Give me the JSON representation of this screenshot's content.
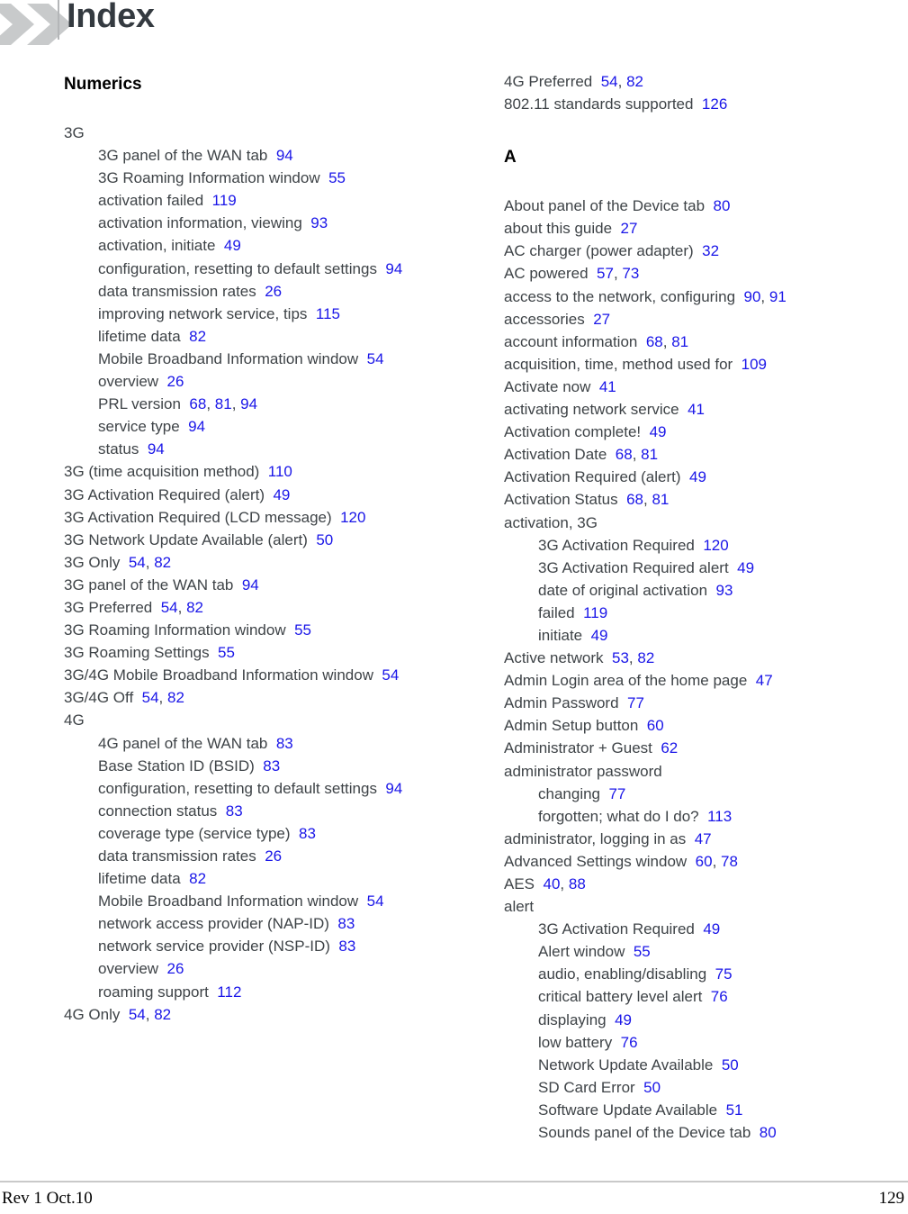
{
  "header": {
    "title": "Index",
    "chevron_icon": "double-chevron-right-icon",
    "chevron_color": "#c8cacb",
    "title_color": "#343a40"
  },
  "theme": {
    "body_text_color": "#3e4347",
    "page_number_color": "#1a16e8",
    "heading_color": "#000000",
    "rule_color": "#c9c9c9"
  },
  "columns": [
    {
      "name": "left-column",
      "sections": [
        {
          "heading": "Numerics",
          "entries": [
            {
              "level": 1,
              "text": "3G",
              "pages": []
            },
            {
              "level": 2,
              "text": "3G panel of the WAN tab",
              "pages": [
                "94"
              ]
            },
            {
              "level": 2,
              "text": "3G Roaming Information window",
              "pages": [
                "55"
              ]
            },
            {
              "level": 2,
              "text": "activation failed",
              "pages": [
                "119"
              ]
            },
            {
              "level": 2,
              "text": "activation information, viewing",
              "pages": [
                "93"
              ]
            },
            {
              "level": 2,
              "text": "activation, initiate",
              "pages": [
                "49"
              ]
            },
            {
              "level": 2,
              "wrap": true,
              "text": "configuration, resetting to default settings",
              "pages": [
                "94"
              ]
            },
            {
              "level": 2,
              "text": "data transmission rates",
              "pages": [
                "26"
              ]
            },
            {
              "level": 2,
              "text": "improving network service, tips",
              "pages": [
                "115"
              ]
            },
            {
              "level": 2,
              "text": "lifetime data",
              "pages": [
                "82"
              ]
            },
            {
              "level": 2,
              "wrap": true,
              "text": "Mobile Broadband Information window",
              "pages": [
                "54"
              ]
            },
            {
              "level": 2,
              "text": "overview",
              "pages": [
                "26"
              ]
            },
            {
              "level": 2,
              "text": "PRL version",
              "pages": [
                "68",
                "81",
                "94"
              ]
            },
            {
              "level": 2,
              "text": "service type",
              "pages": [
                "94"
              ]
            },
            {
              "level": 2,
              "text": "status",
              "pages": [
                "94"
              ]
            },
            {
              "level": 1,
              "text": "3G (time acquisition method)",
              "pages": [
                "110"
              ]
            },
            {
              "level": 1,
              "text": "3G Activation Required (alert)",
              "pages": [
                "49"
              ]
            },
            {
              "level": 1,
              "text": "3G Activation Required (LCD message)",
              "pages": [
                "120"
              ]
            },
            {
              "level": 1,
              "text": "3G Network Update Available (alert)",
              "pages": [
                "50"
              ]
            },
            {
              "level": 1,
              "text": "3G Only",
              "pages": [
                "54",
                "82"
              ]
            },
            {
              "level": 1,
              "text": "3G panel of the WAN tab",
              "pages": [
                "94"
              ]
            },
            {
              "level": 1,
              "text": "3G Preferred",
              "pages": [
                "54",
                "82"
              ]
            },
            {
              "level": 1,
              "text": "3G Roaming Information window",
              "pages": [
                "55"
              ]
            },
            {
              "level": 1,
              "text": "3G Roaming Settings",
              "pages": [
                "55"
              ]
            },
            {
              "level": 1,
              "wrap": true,
              "text": "3G/4G Mobile Broadband Information window",
              "pages": [
                "54"
              ]
            },
            {
              "level": 1,
              "text": "3G/4G Off",
              "pages": [
                "54",
                "82"
              ]
            },
            {
              "level": 1,
              "text": "4G",
              "pages": []
            },
            {
              "level": 2,
              "text": "4G panel of the WAN tab",
              "pages": [
                "83"
              ]
            },
            {
              "level": 2,
              "text": "Base Station ID (BSID)",
              "pages": [
                "83"
              ]
            },
            {
              "level": 2,
              "wrap": true,
              "text": "configuration, resetting to default settings",
              "pages": [
                "94"
              ]
            },
            {
              "level": 2,
              "text": "connection status",
              "pages": [
                "83"
              ]
            },
            {
              "level": 2,
              "text": "coverage type (service type)",
              "pages": [
                "83"
              ]
            },
            {
              "level": 2,
              "text": "data transmission rates",
              "pages": [
                "26"
              ]
            },
            {
              "level": 2,
              "text": "lifetime data",
              "pages": [
                "82"
              ]
            },
            {
              "level": 2,
              "wrap": true,
              "text": "Mobile Broadband Information window",
              "pages": [
                "54"
              ]
            },
            {
              "level": 2,
              "text": "network access provider (NAP-ID)",
              "pages": [
                "83"
              ]
            },
            {
              "level": 2,
              "text": "network service provider (NSP-ID)",
              "pages": [
                "83"
              ]
            },
            {
              "level": 2,
              "text": "overview",
              "pages": [
                "26"
              ]
            },
            {
              "level": 2,
              "text": "roaming support",
              "pages": [
                "112"
              ]
            },
            {
              "level": 1,
              "text": "4G Only",
              "pages": [
                "54",
                "82"
              ]
            }
          ]
        }
      ]
    },
    {
      "name": "right-column",
      "sections": [
        {
          "heading": null,
          "entries": [
            {
              "level": 1,
              "text": "4G Preferred",
              "pages": [
                "54",
                "82"
              ]
            },
            {
              "level": 1,
              "text": "802.11 standards supported",
              "pages": [
                "126"
              ]
            }
          ]
        },
        {
          "heading": "A",
          "entries": [
            {
              "level": 1,
              "text": "About panel of the Device tab",
              "pages": [
                "80"
              ]
            },
            {
              "level": 1,
              "text": "about this guide",
              "pages": [
                "27"
              ]
            },
            {
              "level": 1,
              "text": "AC charger (power adapter)",
              "pages": [
                "32"
              ]
            },
            {
              "level": 1,
              "text": "AC powered",
              "pages": [
                "57",
                "73"
              ]
            },
            {
              "level": 1,
              "text": "access to the network, configuring",
              "pages": [
                "90",
                "91"
              ]
            },
            {
              "level": 1,
              "text": "accessories",
              "pages": [
                "27"
              ]
            },
            {
              "level": 1,
              "text": "account information",
              "pages": [
                "68",
                "81"
              ]
            },
            {
              "level": 1,
              "text": "acquisition, time, method used for",
              "pages": [
                "109"
              ]
            },
            {
              "level": 1,
              "text": "Activate now",
              "pages": [
                "41"
              ]
            },
            {
              "level": 1,
              "text": "activating network service",
              "pages": [
                "41"
              ]
            },
            {
              "level": 1,
              "text": "Activation complete!",
              "pages": [
                "49"
              ]
            },
            {
              "level": 1,
              "text": "Activation Date",
              "pages": [
                "68",
                "81"
              ]
            },
            {
              "level": 1,
              "text": "Activation Required (alert)",
              "pages": [
                "49"
              ]
            },
            {
              "level": 1,
              "text": "Activation Status",
              "pages": [
                "68",
                "81"
              ]
            },
            {
              "level": 1,
              "text": "activation, 3G",
              "pages": []
            },
            {
              "level": 2,
              "text": "3G Activation Required",
              "pages": [
                "120"
              ]
            },
            {
              "level": 2,
              "text": "3G Activation Required alert",
              "pages": [
                "49"
              ]
            },
            {
              "level": 2,
              "text": "date of original activation",
              "pages": [
                "93"
              ]
            },
            {
              "level": 2,
              "text": "failed",
              "pages": [
                "119"
              ]
            },
            {
              "level": 2,
              "text": "initiate",
              "pages": [
                "49"
              ]
            },
            {
              "level": 1,
              "text": "Active network",
              "pages": [
                "53",
                "82"
              ]
            },
            {
              "level": 1,
              "text": "Admin Login area of the home page",
              "pages": [
                "47"
              ]
            },
            {
              "level": 1,
              "text": "Admin Password",
              "pages": [
                "77"
              ]
            },
            {
              "level": 1,
              "text": "Admin Setup button",
              "pages": [
                "60"
              ]
            },
            {
              "level": 1,
              "text": "Administrator + Guest",
              "pages": [
                "62"
              ]
            },
            {
              "level": 1,
              "text": "administrator password",
              "pages": []
            },
            {
              "level": 2,
              "text": "changing",
              "pages": [
                "77"
              ]
            },
            {
              "level": 2,
              "text": "forgotten; what do I do?",
              "pages": [
                "113"
              ]
            },
            {
              "level": 1,
              "text": "administrator, logging in as",
              "pages": [
                "47"
              ]
            },
            {
              "level": 1,
              "text": "Advanced Settings window",
              "pages": [
                "60",
                "78"
              ]
            },
            {
              "level": 1,
              "text": "AES",
              "pages": [
                "40",
                "88"
              ]
            },
            {
              "level": 1,
              "text": "alert",
              "pages": []
            },
            {
              "level": 2,
              "text": "3G Activation Required",
              "pages": [
                "49"
              ]
            },
            {
              "level": 2,
              "text": "Alert window",
              "pages": [
                "55"
              ]
            },
            {
              "level": 2,
              "text": "audio, enabling/disabling",
              "pages": [
                "75"
              ]
            },
            {
              "level": 2,
              "text": "critical battery level alert",
              "pages": [
                "76"
              ]
            },
            {
              "level": 2,
              "text": "displaying",
              "pages": [
                "49"
              ]
            },
            {
              "level": 2,
              "text": "low battery",
              "pages": [
                "76"
              ]
            },
            {
              "level": 2,
              "text": "Network Update Available",
              "pages": [
                "50"
              ]
            },
            {
              "level": 2,
              "text": "SD Card Error",
              "pages": [
                "50"
              ]
            },
            {
              "level": 2,
              "text": "Software Update Available",
              "pages": [
                "51"
              ]
            },
            {
              "level": 2,
              "text": "Sounds panel of the Device tab",
              "pages": [
                "80"
              ]
            }
          ]
        }
      ]
    }
  ],
  "footer": {
    "revision": "Rev 1  Oct.10",
    "page_number": "129"
  }
}
